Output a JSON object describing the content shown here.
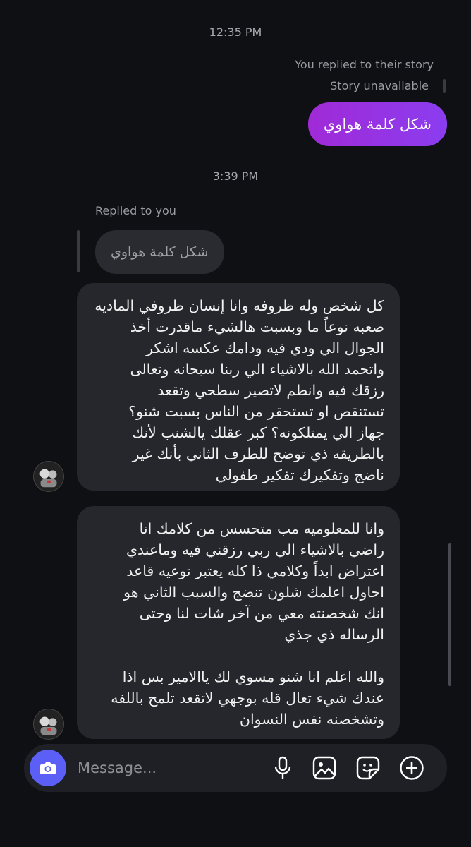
{
  "timestamps": [
    "12:35 PM",
    "3:39 PM"
  ],
  "story_reply": {
    "label": "You replied to their story",
    "status": "Story unavailable"
  },
  "sent_message": "شكل كلمة هواوي",
  "reply": {
    "label": "Replied to you",
    "quoted_text": "شكل كلمة هواوي"
  },
  "received_messages": [
    "كل شخص وله ظروفه وانا إنسان ظروفي الماديه\nصعبه نوعاً ما وبسبت هالشيء ماقدرت أخذ\nالجوال الي ودي فيه ودامك عكسه اشكر\nواتحمد الله بالاشياء الي ربنا سبحانه وتعالى\nرزقك فيه وانطم لاتصير سطحي وتقعد\nتستنقص او تستحقر من الناس بسبت شنو؟\nجهاز الي يمتلكونه؟ كبر عقلك يالشنب لأنك\nبالطريقه ذي توضح للطرف الثاني بأنك غير\nناضج وتفكيرك تفكير طفولي",
    "وانا للمعلوميه مب متحسس من كلامك انا\nراضي بالاشياء الي ربي رزقني فيه وماعندي\nاعتراض ابداً وكلامي ذا كله يعتبر توعيه قاعد\nاحاول اعلمك شلون تنضج والسبب الثاني هو\nانك شخصنته معي من آخر شات لنا وحتى\nالرساله ذي جذي\n\nوالله اعلم انا شنو مسوي لك ياالامير بس اذا\nعندك شيء تعال قله بوجهي لاتقعد تلمح باللفه\nوتشخصنه نفس النسوان"
  ],
  "composer": {
    "placeholder": "Message...",
    "camera_icon": "camera-icon",
    "tools": [
      "microphone-icon",
      "gallery-icon",
      "sticker-icon",
      "add-icon"
    ]
  },
  "colors": {
    "background": "#0f1014",
    "sent_bubble_start": "#a02ad6",
    "sent_bubble_end": "#8b3df0",
    "received_bubble": "#26272c",
    "camera_button": "#5b5ff5"
  }
}
